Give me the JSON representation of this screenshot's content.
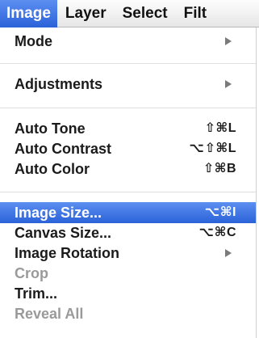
{
  "menubar": {
    "items": [
      {
        "label": "Image",
        "active": true
      },
      {
        "label": "Layer"
      },
      {
        "label": "Select"
      },
      {
        "label": "Filt"
      }
    ]
  },
  "menu": {
    "mode": {
      "label": "Mode",
      "submenu_icon": "submenu-arrow-icon"
    },
    "adjustments": {
      "label": "Adjustments",
      "submenu_icon": "submenu-arrow-icon"
    },
    "auto_tone": {
      "label": "Auto Tone",
      "shortcut": "⇧⌘L"
    },
    "auto_contrast": {
      "label": "Auto Contrast",
      "shortcut": "⌥⇧⌘L"
    },
    "auto_color": {
      "label": "Auto Color",
      "shortcut": "⇧⌘B"
    },
    "image_size": {
      "label": "Image Size...",
      "shortcut": "⌥⌘I",
      "highlighted": true
    },
    "canvas_size": {
      "label": "Canvas Size...",
      "shortcut": "⌥⌘C"
    },
    "image_rotation": {
      "label": "Image Rotation",
      "submenu_icon": "submenu-arrow-icon"
    },
    "crop": {
      "label": "Crop",
      "disabled": true
    },
    "trim": {
      "label": "Trim..."
    },
    "reveal_all": {
      "label": "Reveal All",
      "disabled": true
    }
  },
  "colors": {
    "highlight": "#2f6ae0",
    "disabled_text": "#9a9a9a",
    "text": "#1b1b1b"
  }
}
